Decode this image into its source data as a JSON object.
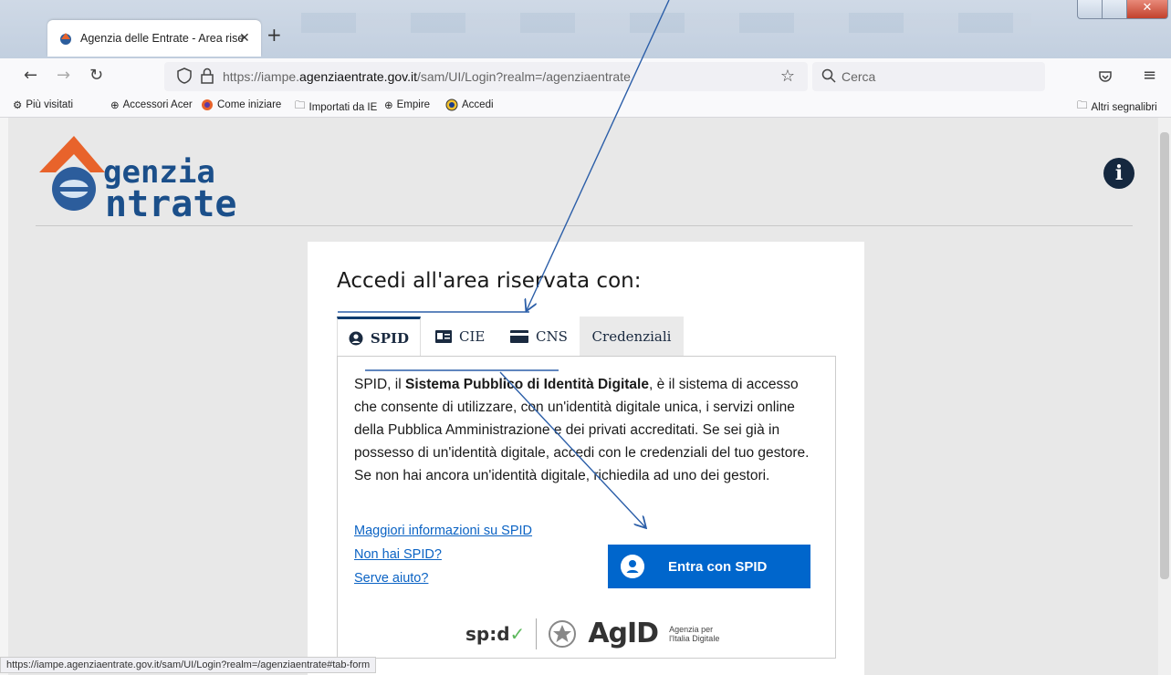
{
  "browser": {
    "tab_title": "Agenzia delle Entrate - Area rise",
    "tab_close": "✕",
    "new_tab": "+",
    "url_host_prefix": "https://iampe.",
    "url_host": "agenziaentrate.gov.it",
    "url_path": "/sam/UI/Login?realm=/agenziaentrate",
    "search_placeholder": "Cerca",
    "bookmarks": [
      {
        "label": "Più visitati",
        "icon": "gear-icon"
      },
      {
        "label": "Accessori Acer",
        "icon": "globe-icon"
      },
      {
        "label": "Come iniziare",
        "icon": "firefox-icon"
      },
      {
        "label": "Importati da IE",
        "icon": "folder-icon"
      },
      {
        "label": "Empire",
        "icon": "globe-icon"
      },
      {
        "label": "Accedi",
        "icon": "accedi-icon"
      }
    ],
    "other_bookmarks": "Altri segnalibri",
    "status_url": "https://iampe.agenziaentrate.gov.it/sam/UI/Login?realm=/agenziaentrate#tab-form"
  },
  "page": {
    "logo_line1": "genzia",
    "logo_line2": "ntrate",
    "heading": "Accedi all'area riservata con:",
    "tabs": [
      {
        "label": "SPID",
        "active": true
      },
      {
        "label": "CIE",
        "active": false
      },
      {
        "label": "CNS",
        "active": false
      },
      {
        "label": "Credenziali",
        "active": false
      }
    ],
    "desc_pre": "SPID, il ",
    "desc_bold": "Sistema Pubblico di Identità Digitale",
    "desc_post": ", è il sistema di accesso che consente di utilizzare, con un'identità digitale unica, i servizi online della Pubblica Amministrazione e dei privati accreditati. Se sei già in possesso di un'identità digitale, accedi con le credenziali del tuo gestore. Se non hai ancora un'identità digitale, richiedila ad uno dei gestori.",
    "links": [
      "Maggiori informazioni su SPID",
      "Non hai SPID?",
      "Serve aiuto?"
    ],
    "spid_button": "Entra con SPID",
    "footer_spid": "sp:d",
    "footer_agid": "AgID",
    "footer_agid_sub1": "Agenzia per",
    "footer_agid_sub2": "l'Italia Digitale"
  },
  "colors": {
    "accent": "#0066cc",
    "brand": "#1b4f8a",
    "logo_orange": "#e8632b",
    "annotation": "#2b5ea8"
  }
}
